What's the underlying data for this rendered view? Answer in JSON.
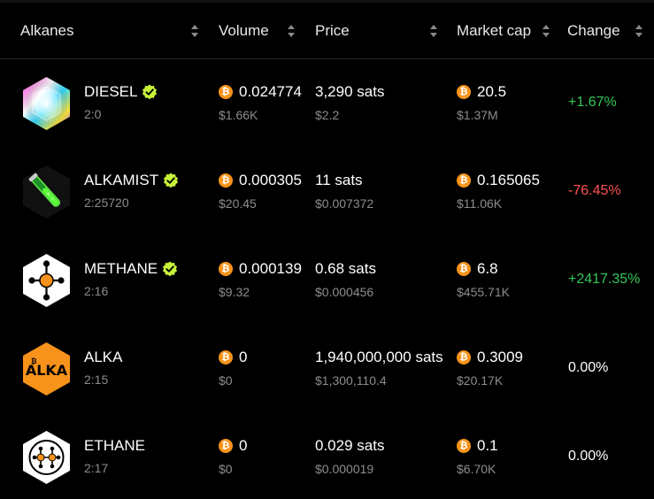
{
  "header": {
    "col_name": "Alkanes",
    "col_volume": "Volume",
    "col_price": "Price",
    "col_mcap": "Market cap",
    "col_change": "Change"
  },
  "colors": {
    "positive": "#34c759",
    "negative": "#ff5252",
    "bitcoin": "#f7931a",
    "verified": "#c6f23a"
  },
  "rows": [
    {
      "name": "DIESEL",
      "id": "2:0",
      "verified": true,
      "logo": "diesel-logo",
      "volume_btc": "0.024774",
      "volume_usd": "$1.66K",
      "price_sats": "3,290 sats",
      "price_usd": "$2.2",
      "mcap_btc": "20.5",
      "mcap_usd": "$1.37M",
      "change": "+1.67%",
      "change_state": "pos"
    },
    {
      "name": "ALKAMIST",
      "id": "2:25720",
      "verified": true,
      "logo": "alkamist-logo",
      "volume_btc": "0.000305",
      "volume_usd": "$20.45",
      "price_sats": "11 sats",
      "price_usd": "$0.007372",
      "mcap_btc": "0.165065",
      "mcap_usd": "$11.06K",
      "change": "-76.45%",
      "change_state": "neg"
    },
    {
      "name": "METHANE",
      "id": "2:16",
      "verified": true,
      "logo": "methane-logo",
      "volume_btc": "0.000139",
      "volume_usd": "$9.32",
      "price_sats": "0.68 sats",
      "price_usd": "$0.000456",
      "mcap_btc": "6.8",
      "mcap_usd": "$455.71K",
      "change": "+2417.35%",
      "change_state": "pos"
    },
    {
      "name": "ALKA",
      "id": "2:15",
      "verified": false,
      "logo": "alka-logo",
      "logo_text": "ALKA",
      "volume_btc": "0",
      "volume_usd": "$0",
      "price_sats": "1,940,000,000 sats",
      "price_usd": "$1,300,110.4",
      "mcap_btc": "0.3009",
      "mcap_usd": "$20.17K",
      "change": "0.00%",
      "change_state": "neu"
    },
    {
      "name": "ETHANE",
      "id": "2:17",
      "verified": false,
      "logo": "ethane-logo",
      "volume_btc": "0",
      "volume_usd": "$0",
      "price_sats": "0.029 sats",
      "price_usd": "$0.000019",
      "mcap_btc": "0.1",
      "mcap_usd": "$6.70K",
      "change": "0.00%",
      "change_state": "neu"
    }
  ]
}
